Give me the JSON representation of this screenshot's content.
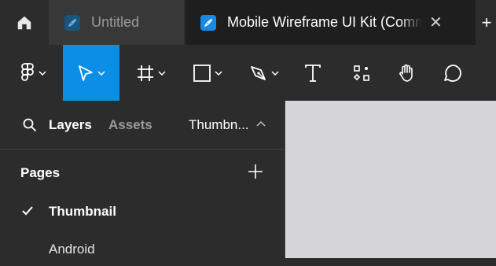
{
  "tabs": {
    "untitled_label": "Untitled",
    "active_label": "Mobile Wireframe UI Kit (Community)",
    "close_glyph": "✕",
    "more_glyph": "+"
  },
  "toolbar": {
    "tools": [
      "main-menu",
      "move",
      "frame",
      "shape",
      "pen",
      "text",
      "resources",
      "hand",
      "comment"
    ],
    "active_tool": "move"
  },
  "panel": {
    "tabs": {
      "layers": "Layers",
      "assets": "Assets",
      "current_page": "Thumbn..."
    },
    "pages_header": "Pages",
    "pages": [
      {
        "label": "Thumbnail",
        "selected": true
      },
      {
        "label": "Android",
        "selected": false
      }
    ]
  },
  "colors": {
    "accent": "#0d8ee6",
    "panel": "#2c2c2c",
    "canvas": "#d6d6da"
  }
}
